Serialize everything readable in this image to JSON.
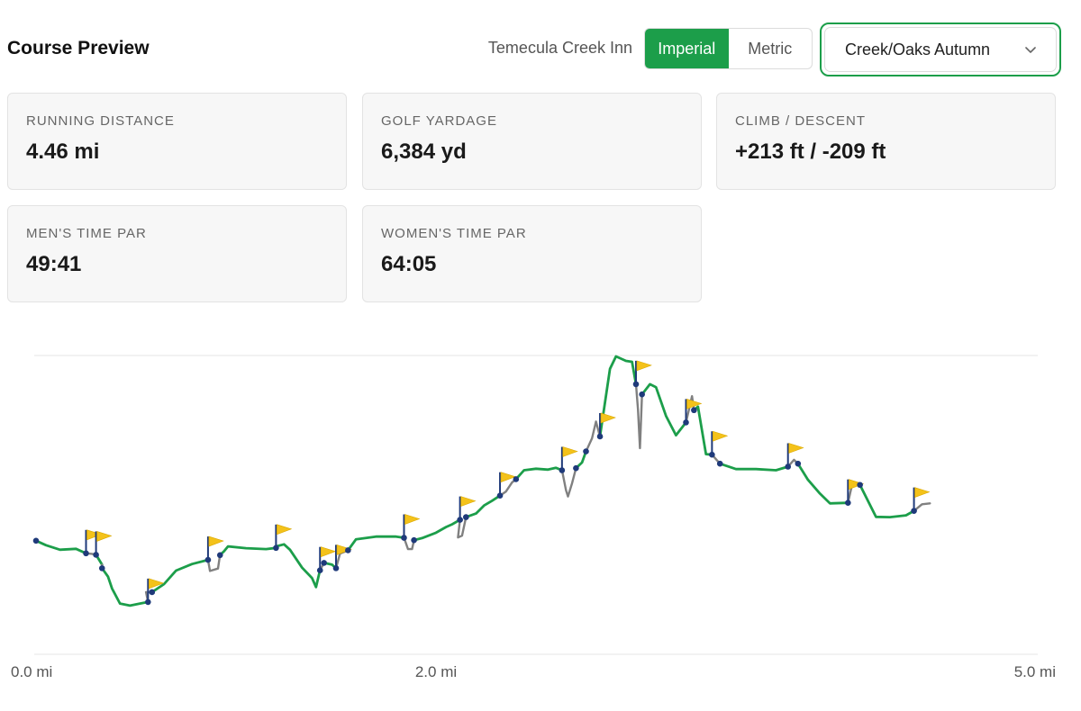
{
  "header": {
    "title": "Course Preview",
    "course_name": "Temecula Creek Inn",
    "units": {
      "imperial_label": "Imperial",
      "metric_label": "Metric",
      "selected": "Imperial"
    },
    "course_select": {
      "selected": "Creek/Oaks Autumn"
    }
  },
  "stats": [
    {
      "label": "RUNNING DISTANCE",
      "value": "4.46 mi"
    },
    {
      "label": "GOLF YARDAGE",
      "value": "6,384 yd"
    },
    {
      "label": "CLIMB / DESCENT",
      "value": "+213 ft / -209 ft"
    },
    {
      "label": "MEN'S TIME PAR",
      "value": "49:41"
    },
    {
      "label": "WOMEN'S TIME PAR",
      "value": "64:05"
    }
  ],
  "colors": {
    "accent": "#1c9e4a",
    "running_line": "#1c9e4a",
    "golf_line": "#808080",
    "marker": "#1f3a7a",
    "flag": "#f4c21a"
  },
  "chart_data": {
    "type": "line",
    "xlabel": "",
    "ylabel": "",
    "xlim": [
      0,
      5.0
    ],
    "x_ticks": [
      "0.0 mi",
      "2.0 mi",
      "5.0 mi"
    ],
    "x_tick_values": [
      0,
      2.0,
      5.0
    ],
    "ylim": [
      0,
      100
    ],
    "y_hidden": true,
    "grid": "horizontal",
    "series": [
      {
        "style": "running",
        "segments": [
          [
            [
              0.0,
              38
            ],
            [
              0.05,
              36.5
            ],
            [
              0.12,
              35
            ],
            [
              0.2,
              35.3
            ],
            [
              0.25,
              33.8
            ]
          ],
          [
            [
              0.3,
              33.3
            ],
            [
              0.33,
              30
            ]
          ],
          [
            [
              0.33,
              28.8
            ],
            [
              0.36,
              26
            ],
            [
              0.38,
              22
            ],
            [
              0.42,
              17
            ],
            [
              0.47,
              16.3
            ],
            [
              0.52,
              17
            ],
            [
              0.56,
              17.5
            ]
          ],
          [
            [
              0.58,
              20.8
            ],
            [
              0.64,
              23.5
            ],
            [
              0.7,
              28
            ],
            [
              0.78,
              30.2
            ],
            [
              0.86,
              31.6
            ]
          ],
          [
            [
              0.92,
              33.2
            ],
            [
              0.94,
              34.5
            ],
            [
              0.96,
              36.1
            ],
            [
              1.05,
              35.5
            ],
            [
              1.15,
              35.2
            ],
            [
              1.2,
              35.6
            ]
          ],
          [
            [
              1.2,
              36.1
            ],
            [
              1.24,
              36.8
            ],
            [
              1.27,
              35
            ],
            [
              1.33,
              29
            ],
            [
              1.38,
              25.5
            ],
            [
              1.4,
              22.5
            ],
            [
              1.42,
              28.1
            ]
          ],
          [
            [
              1.44,
              30.6
            ],
            [
              1.48,
              30
            ],
            [
              1.5,
              28.8
            ]
          ],
          [
            [
              1.56,
              34.8
            ],
            [
              1.6,
              38.5
            ],
            [
              1.7,
              39.4
            ],
            [
              1.8,
              39.4
            ],
            [
              1.84,
              39
            ]
          ],
          [
            [
              1.89,
              38.2
            ],
            [
              1.93,
              38.9
            ],
            [
              2.0,
              40.7
            ],
            [
              2.05,
              42.6
            ],
            [
              2.08,
              43.5
            ],
            [
              2.12,
              45
            ]
          ],
          [
            [
              2.15,
              45.9
            ],
            [
              2.2,
              47.1
            ],
            [
              2.24,
              49.8
            ],
            [
              2.28,
              51.4
            ],
            [
              2.32,
              53.1
            ]
          ],
          [
            [
              2.4,
              58.6
            ],
            [
              2.44,
              61.6
            ],
            [
              2.5,
              62.1
            ],
            [
              2.56,
              61.8
            ],
            [
              2.6,
              62.4
            ],
            [
              2.63,
              61.6
            ]
          ],
          [
            [
              2.7,
              62.3
            ],
            [
              2.73,
              64.2
            ],
            [
              2.75,
              67.9
            ]
          ],
          [
            [
              2.82,
              72.9
            ],
            [
              2.87,
              95.5
            ],
            [
              2.9,
              99.7
            ],
            [
              2.95,
              98.2
            ],
            [
              2.98,
              97.9
            ],
            [
              3.0,
              90.4
            ]
          ],
          [
            [
              3.03,
              87
            ],
            [
              3.07,
              90.4
            ],
            [
              3.1,
              89.4
            ],
            [
              3.15,
              79.8
            ],
            [
              3.2,
              73.3
            ],
            [
              3.25,
              77.6
            ]
          ],
          [
            [
              3.29,
              81.7
            ],
            [
              3.31,
              82.9
            ],
            [
              3.35,
              67
            ],
            [
              3.38,
              66.8
            ]
          ],
          [
            [
              3.42,
              63.8
            ],
            [
              3.5,
              62
            ],
            [
              3.6,
              62
            ],
            [
              3.7,
              61.6
            ],
            [
              3.76,
              62.8
            ]
          ],
          [
            [
              3.81,
              63.8
            ],
            [
              3.86,
              58.4
            ],
            [
              3.92,
              53.8
            ],
            [
              3.97,
              50.5
            ],
            [
              4.06,
              50.7
            ]
          ],
          [
            [
              4.12,
              56.7
            ],
            [
              4.2,
              46
            ],
            [
              4.27,
              45.9
            ],
            [
              4.35,
              46.5
            ],
            [
              4.39,
              48
            ]
          ]
        ]
      },
      {
        "style": "golf",
        "segments": [
          [
            [
              0.25,
              33.8
            ],
            [
              0.28,
              33.6
            ],
            [
              0.3,
              33.3
            ]
          ],
          [
            [
              0.33,
              30
            ],
            [
              0.33,
              28.8
            ]
          ],
          [
            [
              0.56,
              17.5
            ],
            [
              0.55,
              20.8
            ],
            [
              0.58,
              20.8
            ]
          ],
          [
            [
              0.86,
              31.6
            ],
            [
              0.87,
              27.9
            ],
            [
              0.91,
              28.7
            ],
            [
              0.92,
              33.2
            ]
          ],
          [
            [
              1.2,
              35.6
            ],
            [
              1.2,
              36.1
            ]
          ],
          [
            [
              1.42,
              28.1
            ],
            [
              1.44,
              30.6
            ]
          ],
          [
            [
              1.5,
              28.8
            ],
            [
              1.52,
              33.7
            ],
            [
              1.56,
              34.8
            ]
          ],
          [
            [
              1.84,
              39
            ],
            [
              1.86,
              35.2
            ],
            [
              1.88,
              35.2
            ],
            [
              1.89,
              38.2
            ]
          ],
          [
            [
              2.12,
              45
            ],
            [
              2.11,
              39.1
            ],
            [
              2.13,
              39.7
            ],
            [
              2.15,
              45.9
            ]
          ],
          [
            [
              2.32,
              53.1
            ],
            [
              2.35,
              54.5
            ],
            [
              2.38,
              57.5
            ],
            [
              2.4,
              58.6
            ]
          ],
          [
            [
              2.63,
              61.6
            ],
            [
              2.65,
              54.9
            ],
            [
              2.66,
              52.8
            ],
            [
              2.68,
              57.2
            ],
            [
              2.7,
              62.3
            ]
          ],
          [
            [
              2.75,
              67.9
            ],
            [
              2.78,
              72.3
            ],
            [
              2.8,
              77.9
            ],
            [
              2.82,
              72.9
            ]
          ],
          [
            [
              3.0,
              90.4
            ],
            [
              3.01,
              82
            ],
            [
              3.02,
              69
            ],
            [
              3.03,
              87
            ]
          ],
          [
            [
              3.25,
              77.6
            ],
            [
              3.28,
              86.4
            ],
            [
              3.29,
              81.7
            ]
          ],
          [
            [
              3.38,
              66.8
            ],
            [
              3.42,
              63.8
            ]
          ],
          [
            [
              3.76,
              62.8
            ],
            [
              3.79,
              65.1
            ],
            [
              3.81,
              63.8
            ]
          ],
          [
            [
              4.06,
              50.7
            ],
            [
              4.08,
              56.7
            ],
            [
              4.12,
              56.7
            ]
          ],
          [
            [
              4.39,
              48
            ],
            [
              4.43,
              50.2
            ],
            [
              4.47,
              50.5
            ]
          ]
        ]
      }
    ],
    "markers": [
      [
        0.0,
        38
      ],
      [
        0.25,
        33.8
      ],
      [
        0.3,
        33.3
      ],
      [
        0.33,
        28.8
      ],
      [
        0.56,
        17.5
      ],
      [
        0.58,
        20.8
      ],
      [
        0.86,
        31.6
      ],
      [
        0.92,
        33.2
      ],
      [
        1.2,
        35.6
      ],
      [
        1.42,
        28.1
      ],
      [
        1.44,
        30.6
      ],
      [
        1.5,
        28.8
      ],
      [
        1.56,
        34.8
      ],
      [
        1.84,
        39
      ],
      [
        1.89,
        38.2
      ],
      [
        2.12,
        45
      ],
      [
        2.15,
        45.9
      ],
      [
        2.32,
        53.1
      ],
      [
        2.4,
        58.6
      ],
      [
        2.63,
        61.6
      ],
      [
        2.7,
        62.3
      ],
      [
        2.75,
        67.9
      ],
      [
        2.82,
        72.9
      ],
      [
        3.0,
        90.4
      ],
      [
        3.03,
        87
      ],
      [
        3.25,
        77.6
      ],
      [
        3.29,
        81.7
      ],
      [
        3.38,
        66.8
      ],
      [
        3.42,
        63.8
      ],
      [
        3.76,
        62.8
      ],
      [
        3.81,
        63.8
      ],
      [
        4.06,
        50.7
      ],
      [
        4.12,
        56.7
      ],
      [
        4.39,
        48
      ]
    ],
    "flags": [
      [
        0.25,
        33.8
      ],
      [
        0.3,
        33.3
      ],
      [
        0.56,
        17.5
      ],
      [
        0.86,
        31.6
      ],
      [
        1.2,
        35.6
      ],
      [
        1.42,
        28.1
      ],
      [
        1.5,
        28.8
      ],
      [
        1.84,
        39
      ],
      [
        2.12,
        45
      ],
      [
        2.32,
        53.1
      ],
      [
        2.63,
        61.6
      ],
      [
        2.82,
        72.9
      ],
      [
        3.0,
        90.4
      ],
      [
        3.25,
        77.6
      ],
      [
        3.38,
        66.8
      ],
      [
        3.76,
        62.8
      ],
      [
        4.06,
        50.7
      ],
      [
        4.39,
        48
      ]
    ]
  }
}
